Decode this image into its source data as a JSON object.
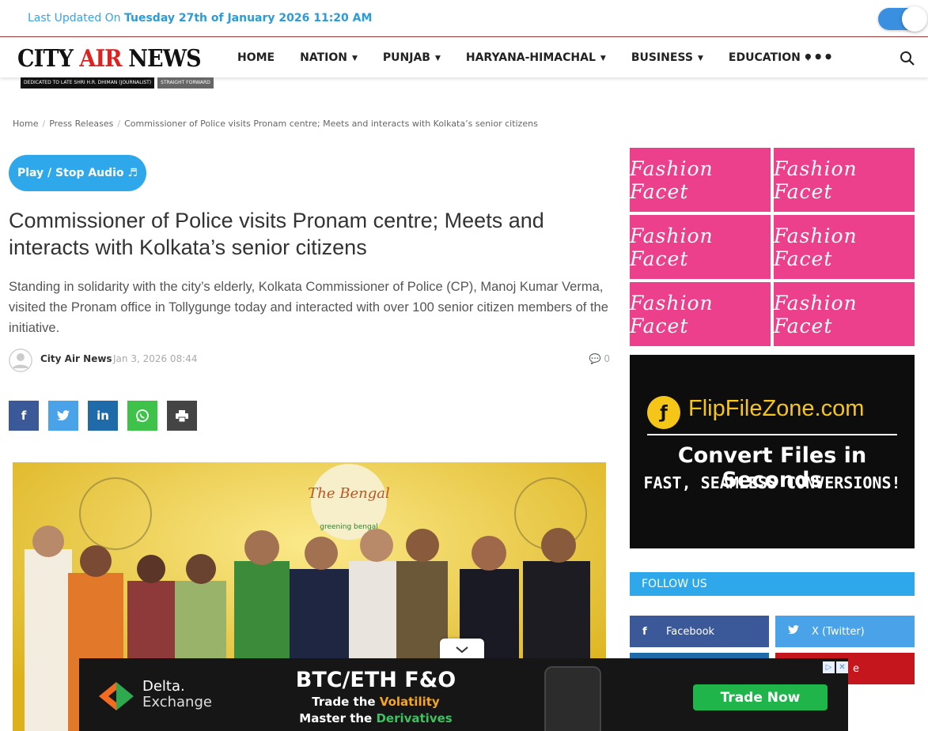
{
  "topbar": {
    "updated_prefix": "Last Updated On",
    "updated_value": "Tuesday 27th of January 2026 11:20 AM"
  },
  "logo": {
    "city": "CITY",
    "air": "AIR",
    "news": "NEWS",
    "dedication": "DEDICATED TO LATE SHRI H.R. DHIMAN (JOURNALIST)",
    "tagline": "STRAIGHT FORWARD"
  },
  "nav": {
    "items": [
      {
        "label": "HOME",
        "dropdown": false
      },
      {
        "label": "NATION",
        "dropdown": true
      },
      {
        "label": "PUNJAB",
        "dropdown": true
      },
      {
        "label": "HARYANA-HIMACHAL",
        "dropdown": true
      },
      {
        "label": "BUSINESS",
        "dropdown": true
      },
      {
        "label": "EDUCATION",
        "dropdown": true
      }
    ],
    "more": "•••"
  },
  "breadcrumb": {
    "home": "Home",
    "section": "Press Releases",
    "current": "Commissioner of Police visits Pronam centre; Meets and interacts with Kolkata’s senior citizens"
  },
  "article": {
    "audio_button": "Play / Stop Audio ♬",
    "title": "Commissioner of Police visits Pronam centre; Meets and interacts with Kolkata’s senior citizens",
    "lead": "Standing in solidarity with the city’s elderly, Kolkata Commissioner of Police (CP), Manoj Kumar Verma, visited the Pronam office in Tollygunge today and interacted with over 100 senior citizen members of the initiative.",
    "author": "City Air News",
    "date": "Jan 3, 2026 08:44",
    "comments": "0",
    "photo_banner_text": "The Bengal",
    "photo_banner_sub": "greening bengal"
  },
  "share": [
    {
      "name": "facebook",
      "glyph": "f",
      "color": "#3b5998"
    },
    {
      "name": "twitter",
      "glyph": "t",
      "color": "#4aa3e8"
    },
    {
      "name": "linkedin",
      "glyph": "in",
      "color": "#1f6aa8"
    },
    {
      "name": "whatsapp",
      "glyph": "w",
      "color": "#3ec24a"
    },
    {
      "name": "print",
      "glyph": "p",
      "color": "#444"
    }
  ],
  "sidebar": {
    "fashion_ads": [
      "Fashion Facet",
      "Fashion Facet",
      "Fashion Facet",
      "Fashion Facet",
      "Fashion Facet",
      "Fashion Facet"
    ],
    "flipfile": {
      "site": "FlipFileZone.com",
      "headline": "Convert Files in Seconds",
      "subline": "FAST, SEAMLESS CONVERSIONS!"
    },
    "follow_title": "FOLLOW US",
    "follow": [
      {
        "label": "Facebook",
        "icon": "f"
      },
      {
        "label": "X (Twitter)",
        "icon": "t"
      },
      {
        "label": "",
        "icon": ""
      },
      {
        "label": "e",
        "icon": ""
      }
    ]
  },
  "bottom_ad": {
    "brand_line1": "Delta.",
    "brand_line2": "Exchange",
    "headline": "BTC/ETH F&O",
    "line1_prefix": "Trade the ",
    "line1_highlight": "Volatility",
    "line2_prefix": "Master the ",
    "line2_highlight": "Derivatives",
    "cta": "Trade Now"
  }
}
